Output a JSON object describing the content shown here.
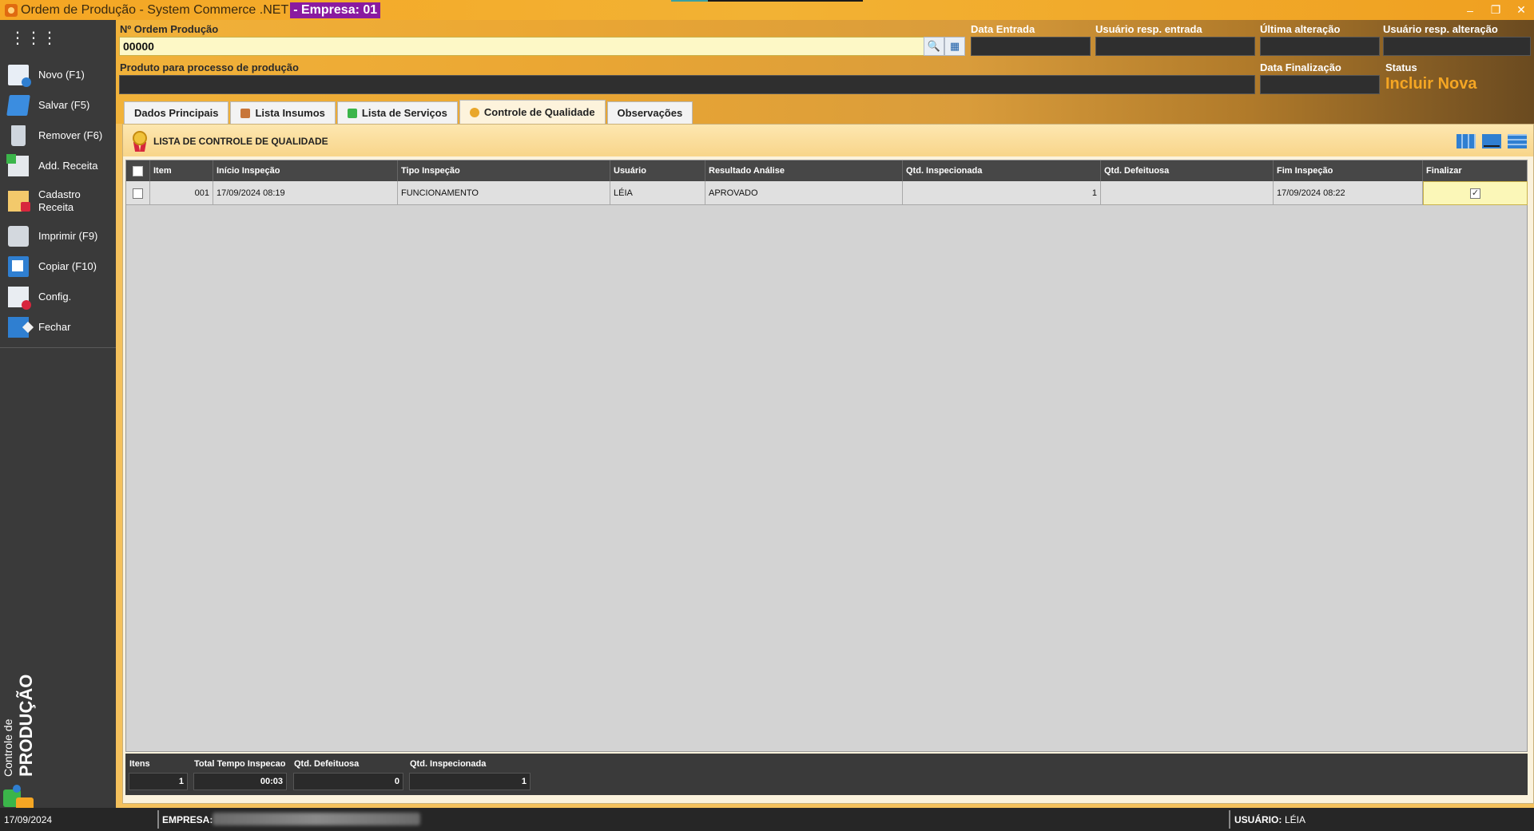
{
  "window": {
    "title": "Ordem de Produção - System  Commerce .NET",
    "empresa_badge": "- Empresa: 01",
    "buttons": [
      "–",
      "❐",
      "✕"
    ]
  },
  "sidebar": {
    "items": [
      {
        "label": "Novo (F1)",
        "icon": "new-document-icon"
      },
      {
        "label": "Salvar (F5)",
        "icon": "save-icon"
      },
      {
        "label": "Remover (F6)",
        "icon": "trash-icon"
      },
      {
        "label": "Add. Receita",
        "icon": "add-recipe-icon"
      },
      {
        "label": "Cadastro Receita",
        "icon": "recipe-register-icon"
      },
      {
        "label": "Imprimir (F9)",
        "icon": "printer-icon"
      },
      {
        "label": "Copiar (F10)",
        "icon": "copy-icon"
      },
      {
        "label": "Config.",
        "icon": "config-icon"
      },
      {
        "label": "Fechar",
        "icon": "exit-icon"
      }
    ],
    "module_small": "Controle de",
    "module_big": "PRODUÇÃO"
  },
  "header": {
    "ordem_label": "Nº Ordem Produção",
    "ordem_value": "00000",
    "data_entrada_label": "Data Entrada",
    "usuario_entrada_label": "Usuário resp. entrada",
    "ultima_alteracao_label": "Última alteração",
    "usuario_alteracao_label": "Usuário resp. alteração",
    "produto_label": "Produto para processo de produção",
    "data_finalizacao_label": "Data Finalização",
    "status_label": "Status",
    "status_value": "Incluir Nova"
  },
  "tabs": [
    {
      "label": "Dados Principais",
      "active": false
    },
    {
      "label": "Lista Insumos",
      "active": false
    },
    {
      "label": "Lista de Serviços",
      "active": false
    },
    {
      "label": "Controle de Qualidade",
      "active": true
    },
    {
      "label": "Observações",
      "active": false
    }
  ],
  "section": {
    "title": "LISTA DE CONTROLE DE QUALIDADE"
  },
  "table": {
    "columns": [
      "Item",
      "Início Inspeção",
      "Tipo Inspeção",
      "Usuário",
      "Resultado Análise",
      "Qtd. Inspecionada",
      "Qtd. Defeituosa",
      "Fim Inspeção",
      "Finalizar"
    ],
    "rows": [
      {
        "item": "001",
        "inicio": "17/09/2024 08:19",
        "tipo": "FUNCIONAMENTO",
        "usuario": "LÉIA",
        "resultado": "APROVADO",
        "qtd_inspecionada": "1",
        "qtd_defeituosa": "",
        "fim": "17/09/2024 08:22",
        "finalizar": "✓"
      }
    ]
  },
  "summary": {
    "itens_label": "Itens",
    "itens_value": "1",
    "tempo_label": "Total Tempo Inspecao",
    "tempo_value": "00:03",
    "defeituosa_label": "Qtd. Defeituosa",
    "defeituosa_value": "0",
    "inspecionada_label": "Qtd. Inspecionada",
    "inspecionada_value": "1"
  },
  "statusbar": {
    "date": "17/09/2024",
    "empresa_label": "EMPRESA:",
    "usuario_label": "USUÁRIO:",
    "usuario_value": "LÉIA"
  },
  "colors": {
    "accent": "#f5a623",
    "empresa_badge": "#8a1aa0",
    "sidebar": "#3a3a3a"
  }
}
